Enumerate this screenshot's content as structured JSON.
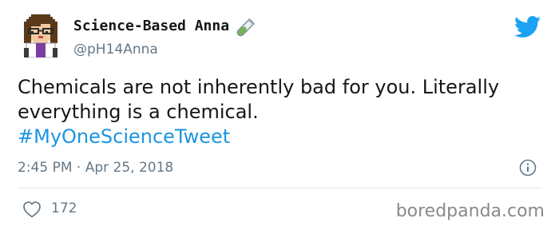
{
  "author": {
    "display_name": "Science-Based Anna",
    "handle": "@pH14Anna",
    "name_emoji_icon": "test-tube-icon",
    "avatar_icon": "pixel-art-avatar"
  },
  "platform_icon": "twitter-bird-icon",
  "tweet": {
    "text_line1": "Chemicals are not inherently bad for you. Literally",
    "text_line2": "everything is a chemical.",
    "hashtag": "#MyOneScienceTweet",
    "timestamp": "2:45 PM · Apr 25, 2018"
  },
  "info_icon": "info-icon",
  "engagement": {
    "like_icon": "heart-icon",
    "like_count": "172"
  },
  "watermark": "boredpanda.com",
  "colors": {
    "hashtag": "#1b95e0",
    "bird": "#1da1f2",
    "secondary_text": "#657786"
  }
}
